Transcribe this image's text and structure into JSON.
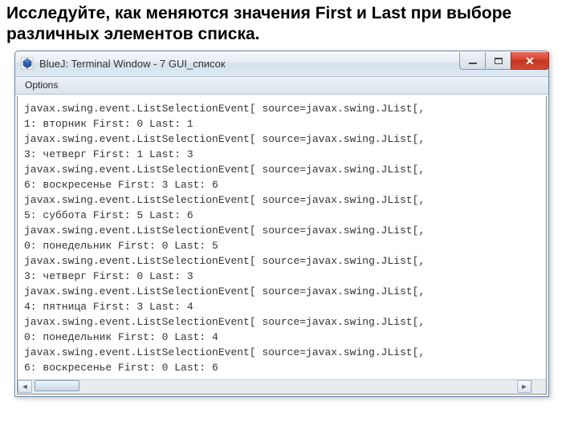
{
  "instruction": "Исследуйте, как меняются значения First и Last при выборе различных элементов списка.",
  "window": {
    "title": "BlueJ:  Terminal Window - 7 GUI_список"
  },
  "menu": {
    "options": "Options"
  },
  "lines": [
    "javax.swing.event.ListSelectionEvent[ source=javax.swing.JList[,",
    "1: вторник First: 0 Last: 1",
    "javax.swing.event.ListSelectionEvent[ source=javax.swing.JList[,",
    "3: четверг First: 1 Last: 3",
    "javax.swing.event.ListSelectionEvent[ source=javax.swing.JList[,",
    "6: воскресенье First: 3 Last: 6",
    "javax.swing.event.ListSelectionEvent[ source=javax.swing.JList[,",
    "5: суббота First: 5 Last: 6",
    "javax.swing.event.ListSelectionEvent[ source=javax.swing.JList[,",
    "0: понедельник First: 0 Last: 5",
    "javax.swing.event.ListSelectionEvent[ source=javax.swing.JList[,",
    "3: четверг First: 0 Last: 3",
    "javax.swing.event.ListSelectionEvent[ source=javax.swing.JList[,",
    "4: пятница First: 3 Last: 4",
    "javax.swing.event.ListSelectionEvent[ source=javax.swing.JList[,",
    "0: понедельник First: 0 Last: 4",
    "javax.swing.event.ListSelectionEvent[ source=javax.swing.JList[,",
    "6: воскресенье First: 0 Last: 6"
  ]
}
